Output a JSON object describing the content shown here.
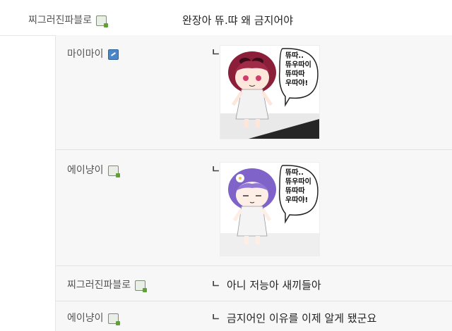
{
  "post": {
    "author": "찌그러진파블로",
    "text": "완장아 뜌.땨 왜 금지어야"
  },
  "replies": [
    {
      "author": "마이마이",
      "badge": "fluid",
      "type": "sticker",
      "bubble": "뜌따..\n뜌우따이\n뜌따따\n우따야!"
    },
    {
      "author": "에이냥이",
      "badge": "fixed",
      "type": "sticker",
      "bubble": "뜌따..\n뜌우따이\n뜌따따\n우따야!"
    },
    {
      "author": "찌그러진파블로",
      "badge": "fixed",
      "text": "아니 저능아 새끼들아"
    },
    {
      "author": "에이냥이",
      "badge": "fixed",
      "text": "금지어인 이유를 이제 알게 됐군요"
    }
  ],
  "reply_marker": "ㄴ",
  "colors": {
    "reply_bg": "#f7f7f7",
    "fixed_badge_green": "#5fa037",
    "fluid_badge_blue": "#4a86c8",
    "sticker1_hair": "#8b1f3a",
    "sticker2_hair": "#7f63c9"
  }
}
